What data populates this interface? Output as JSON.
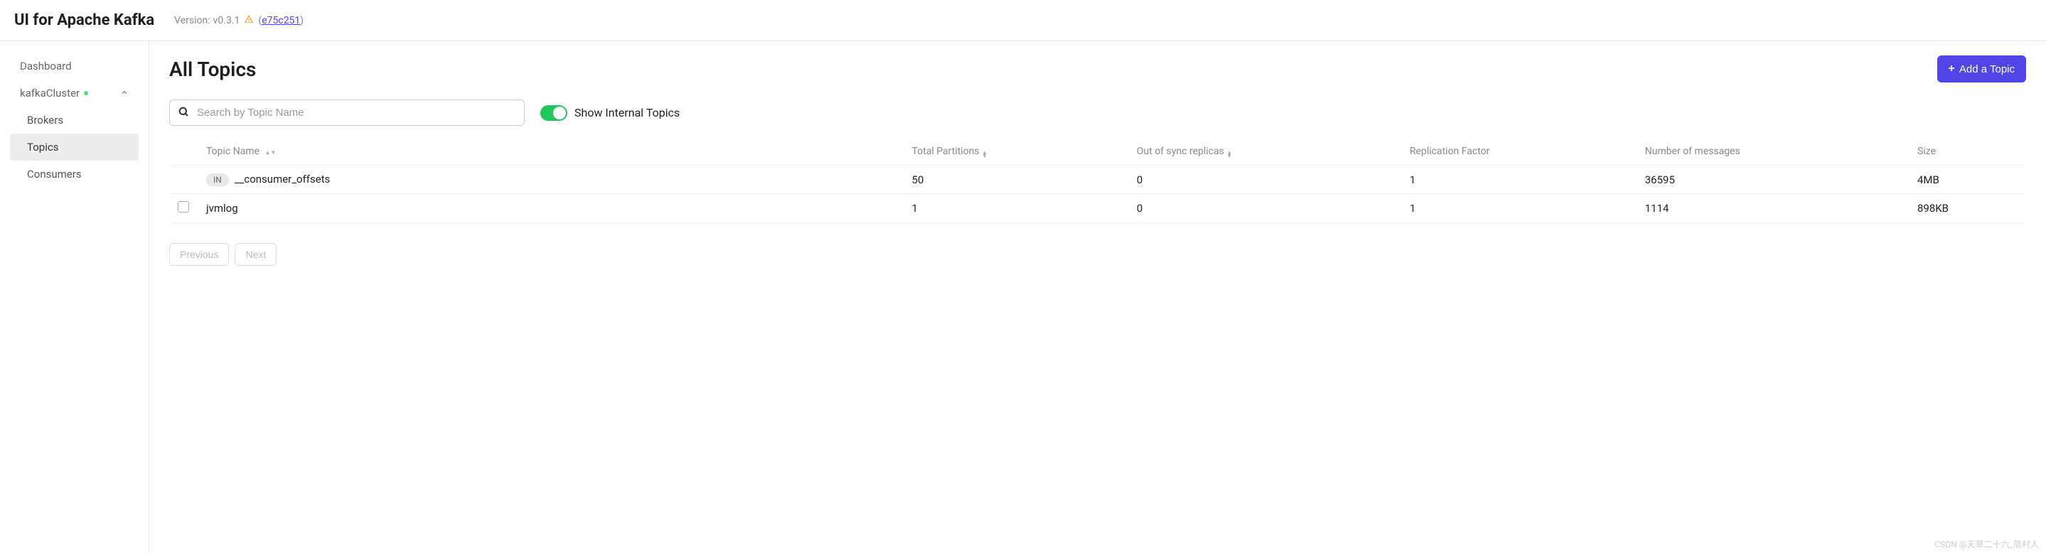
{
  "header": {
    "app_name": "UI for Apache Kafka",
    "version_label": "Version:",
    "version_value": "v0.3.1",
    "commit_hash": "e75c251"
  },
  "sidebar": {
    "dashboard_label": "Dashboard",
    "cluster_name": "kafkaCluster",
    "items": {
      "brokers": "Brokers",
      "topics": "Topics",
      "consumers": "Consumers"
    }
  },
  "page": {
    "title": "All Topics",
    "add_button": "Add a Topic"
  },
  "toolbar": {
    "search_placeholder": "Search by Topic Name",
    "toggle_label": "Show Internal Topics",
    "toggle_on": true
  },
  "table": {
    "headers": {
      "topic_name": "Topic Name",
      "total_partitions": "Total Partitions",
      "out_of_sync": "Out of sync replicas",
      "replication_factor": "Replication Factor",
      "num_messages": "Number of messages",
      "size": "Size"
    },
    "rows": [
      {
        "internal_badge": "IN",
        "is_internal": true,
        "name": "__consumer_offsets",
        "total_partitions": "50",
        "out_of_sync": "0",
        "replication_factor": "1",
        "num_messages": "36595",
        "size": "4MB"
      },
      {
        "is_internal": false,
        "name": "jvmlog",
        "total_partitions": "1",
        "out_of_sync": "0",
        "replication_factor": "1",
        "num_messages": "1114",
        "size": "898KB"
      }
    ]
  },
  "pagination": {
    "previous": "Previous",
    "next": "Next"
  },
  "watermark": "CSDN @天草二十六_简村人"
}
